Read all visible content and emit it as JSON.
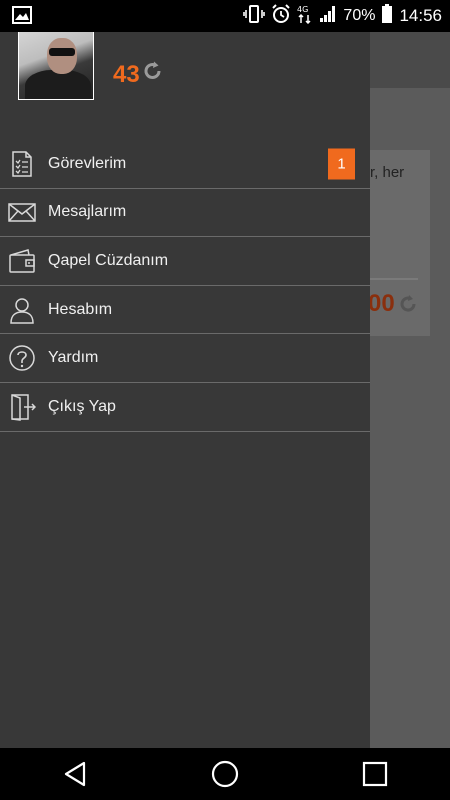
{
  "status_bar": {
    "battery_percent": "70%",
    "time": "14:56",
    "network_label": "4G"
  },
  "background_app": {
    "card_text": "r, her",
    "card_value": "00"
  },
  "profile": {
    "points": "43"
  },
  "menu": {
    "items": [
      {
        "label": "Görevlerim",
        "icon": "tasks-list-icon",
        "badge": "1"
      },
      {
        "label": "Mesajlarım",
        "icon": "envelope-icon"
      },
      {
        "label": "Qapel Cüzdanım",
        "icon": "wallet-icon"
      },
      {
        "label": "Hesabım",
        "icon": "user-icon"
      },
      {
        "label": "Yardım",
        "icon": "help-icon"
      },
      {
        "label": "Çıkış Yap",
        "icon": "logout-icon"
      }
    ]
  },
  "colors": {
    "accent": "#f06a1e",
    "drawer_bg": "#383838",
    "divider": "#6a6a6a"
  }
}
